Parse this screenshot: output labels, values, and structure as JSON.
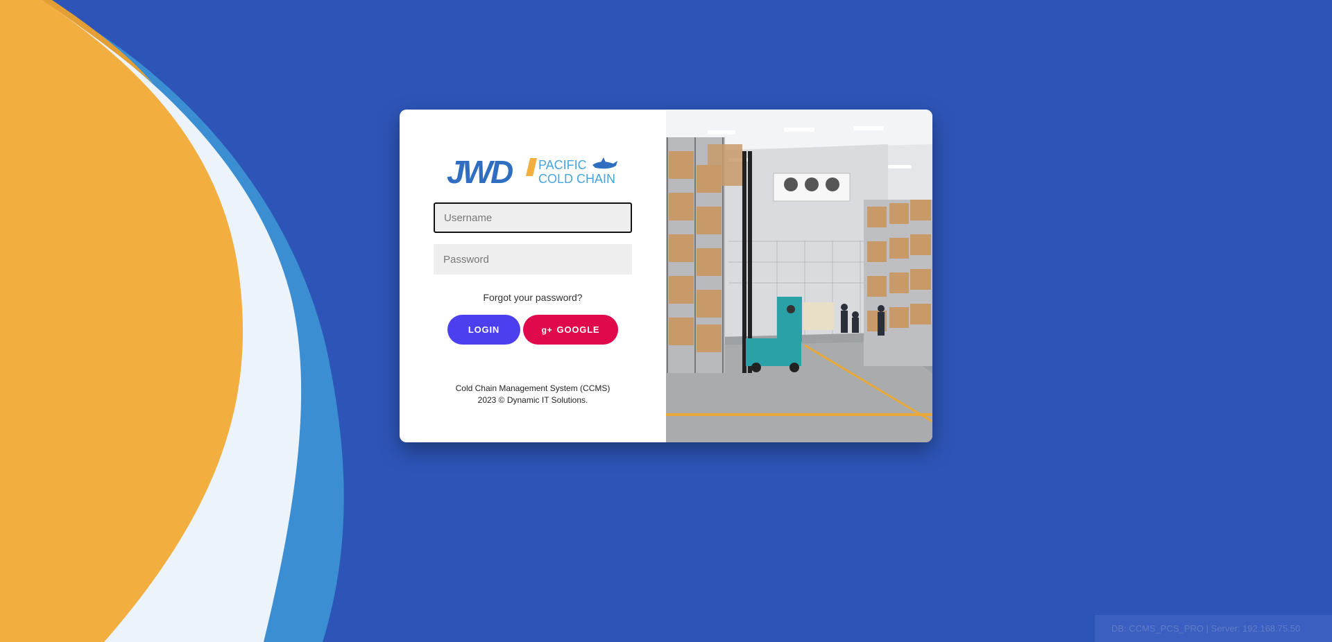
{
  "logo": {
    "mark": "JWD",
    "line1": "PACIFIC",
    "line2": "COLD CHAIN"
  },
  "form": {
    "username_placeholder": "Username",
    "password_placeholder": "Password",
    "forgot_label": "Forgot your password?",
    "login_label": "LOGIN",
    "google_label": "GOOGLE",
    "google_icon": "google-plus-icon"
  },
  "footer": {
    "line1": "Cold Chain Management System (CCMS)",
    "line2": "2023 © Dynamic IT Solutions."
  },
  "server_info": {
    "text": "DB: CCMS_PCS_PRO | Server: 192.168.75.50"
  },
  "colors": {
    "background": "#2d55b8",
    "wave_orange": "#f2ae3f",
    "wave_white": "#edf3fb",
    "wave_blue": "#3a8ed1",
    "login_button": "#4b3ff0",
    "google_button": "#e0094b",
    "logo_blue": "#2f6ec1",
    "logo_light_blue": "#47a4dd",
    "logo_orange": "#f2ae3f"
  }
}
